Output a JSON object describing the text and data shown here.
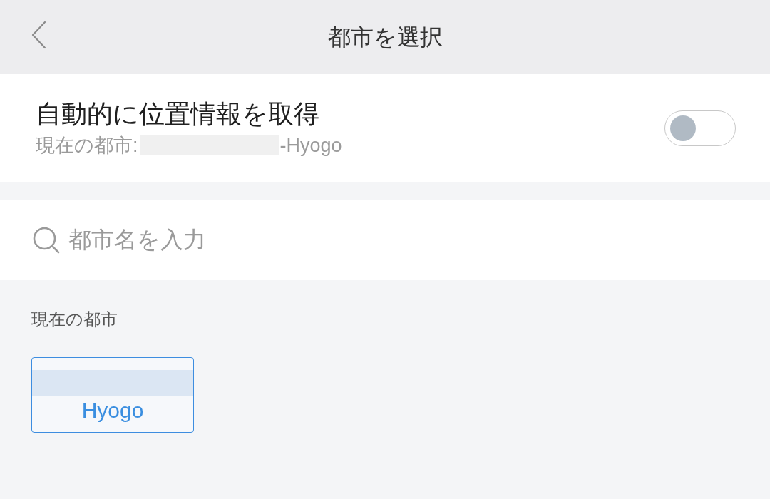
{
  "header": {
    "title": "都市を選択"
  },
  "auto_location": {
    "label": "自動的に位置情報を取得",
    "current_city_label": "現在の都市:",
    "current_city_suffix": "-Hyogo",
    "on": false
  },
  "search": {
    "placeholder": "都市名を入力"
  },
  "current_city_section": {
    "heading": "現在の都市",
    "cities": [
      {
        "name": "Hyogo",
        "selected": true
      }
    ]
  }
}
